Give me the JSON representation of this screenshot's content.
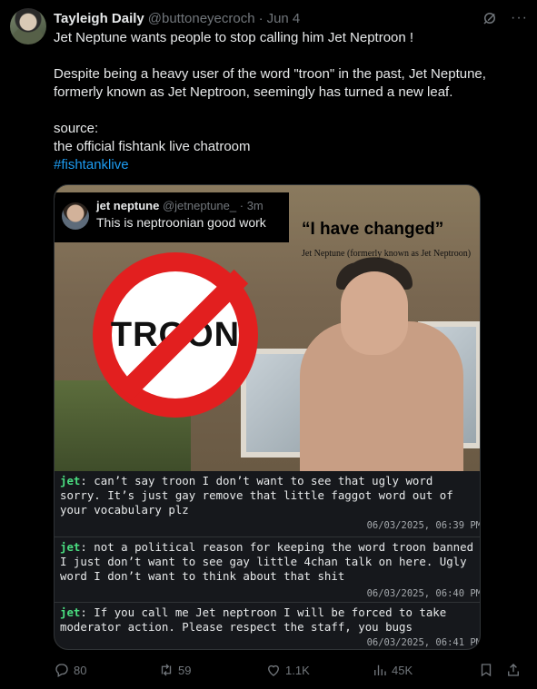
{
  "tweet": {
    "display_name": "Tayleigh Daily",
    "handle": "@buttoneyecroch",
    "separator": "·",
    "date": "Jun 4",
    "text_lines": [
      "Jet Neptune wants people to stop calling him Jet Neptroon !",
      "",
      "Despite being a heavy user of the word \"troon\" in the past, Jet Neptune,",
      "formerly known as Jet Neptroon,  seemingly has turned a new leaf.",
      "",
      "source:",
      "the official fishtank live chatroom"
    ],
    "hashtag": "#fishtanklive"
  },
  "media": {
    "quote": {
      "name": "jet neptune",
      "handle": "@jetneptune_",
      "time": "· 3m",
      "text": "This is neptroonian good work"
    },
    "no_sign_text": "TROON",
    "caption_title": "“I have changed”",
    "caption_sub": "Jet Neptune (formerly known as Jet Neptroon)",
    "chat": [
      {
        "user": "jet",
        "text_lines": [
          ": can’t say troon I don’t want to see that ugly word",
          "sorry. It’s just gay remove that little faggot word out of",
          "your vocabulary plz"
        ],
        "timestamp": "06/03/2025, 06:39 PM"
      },
      {
        "user": "jet",
        "text_lines": [
          ": not a political reason for keeping the word troon banned",
          "I just don’t want to see gay little 4chan talk on here. Ugly",
          "word I don’t want to think about that shit"
        ],
        "timestamp": "06/03/2025, 06:40 PM"
      },
      {
        "user": "jet",
        "text_lines": [
          ": If you call me Jet neptroon I will be forced to take",
          "moderator action. Please respect the staff, you bugs"
        ],
        "timestamp": "06/03/2025, 06:41 PM"
      }
    ]
  },
  "actions": {
    "replies": "80",
    "reposts": "59",
    "likes": "1.1K",
    "views": "45K"
  },
  "icons": {
    "header": [
      "grok-icon",
      "more-icon"
    ],
    "actions": [
      "reply-icon",
      "retweet-icon",
      "like-icon",
      "views-icon",
      "bookmark-icon",
      "share-icon"
    ]
  },
  "colors": {
    "background": "#000000",
    "text": "#e7e9ea",
    "muted": "#71767b",
    "link": "#1d9bf0",
    "chat_user": "#4ade80",
    "no_sign_red": "#e21f1f"
  }
}
